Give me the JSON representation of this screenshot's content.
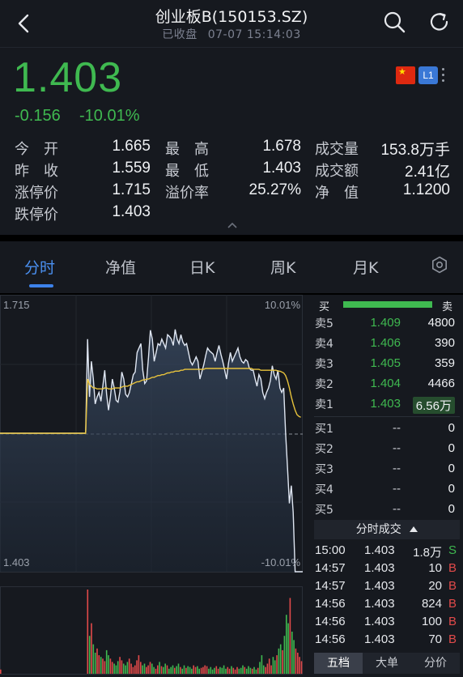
{
  "header": {
    "title": "创业板B(150153.SZ)",
    "status": "已收盘",
    "timestamp": "07-07 15:14:03",
    "icons": [
      "back-icon",
      "search-icon",
      "refresh-icon"
    ]
  },
  "quote": {
    "price": "1.403",
    "change": "-0.156",
    "change_pct": "-10.01%",
    "level_badge": "L1",
    "flag_symbol": "★",
    "up_color": "#e24a4a",
    "down_color": "#3fb950"
  },
  "stats": {
    "open_label": "今　开",
    "open": "1.665",
    "high_label": "最　高",
    "high": "1.678",
    "volume_label": "成交量",
    "volume": "153.8万手",
    "prev_label": "昨　收",
    "prev": "1.559",
    "low_label": "最　低",
    "low": "1.403",
    "amount_label": "成交额",
    "amount": "2.41亿",
    "limit_up_label": "涨停价",
    "limit_up": "1.715",
    "premium_label": "溢价率",
    "premium": "25.27%",
    "nav_label": "净　值",
    "nav": "1.1200",
    "limit_down_label": "跌停价",
    "limit_down": "1.403"
  },
  "tabs": [
    "分时",
    "净值",
    "日K",
    "周K",
    "月K"
  ],
  "chart": {
    "y_max_label": "1.715",
    "y_min_label": "1.403",
    "pct_max_label": "10.01%",
    "pct_min_label": "-10.01%"
  },
  "chart_data": {
    "type": "line",
    "ylim": [
      1.403,
      1.715
    ],
    "prev_close": 1.559,
    "series": [
      {
        "values": [
          1.559,
          1.559,
          1.559,
          1.559,
          1.559,
          1.559,
          1.559,
          1.559,
          1.559,
          1.559,
          1.559,
          1.559,
          1.559,
          1.559,
          1.559,
          1.559,
          1.559,
          1.559,
          1.559,
          1.559,
          1.559,
          1.559,
          1.559,
          1.559,
          1.559,
          1.559,
          1.559,
          1.559,
          1.559,
          1.559,
          1.559,
          1.559,
          1.559,
          1.559,
          1.559,
          1.559,
          1.559,
          1.559,
          1.559,
          1.559,
          1.559,
          1.559,
          1.559,
          1.559,
          1.559,
          1.559,
          1.665,
          1.6,
          1.64,
          1.62,
          1.592,
          1.6,
          1.605,
          1.595,
          1.612,
          1.63,
          1.603,
          1.585,
          1.6,
          1.62,
          1.61,
          1.596,
          1.594,
          1.606,
          1.628,
          1.62,
          1.603,
          1.6,
          1.605,
          1.615,
          1.625,
          1.628,
          1.65,
          1.655,
          1.66,
          1.63,
          1.615,
          1.618,
          1.645,
          1.675,
          1.665,
          1.64,
          1.65,
          1.66,
          1.658,
          1.665,
          1.66,
          1.655,
          1.67,
          1.668,
          1.665,
          1.658,
          1.676,
          1.665,
          1.66,
          1.67,
          1.662,
          1.658,
          1.66,
          1.65,
          1.64,
          1.636,
          1.64,
          1.645,
          1.64,
          1.62,
          1.628,
          1.636,
          1.646,
          1.655,
          1.652,
          1.65,
          1.648,
          1.64,
          1.65,
          1.658,
          1.648,
          1.64,
          1.63,
          1.62,
          1.638,
          1.65,
          1.64,
          1.645,
          1.65,
          1.655,
          1.645,
          1.64,
          1.638,
          1.642,
          1.64,
          1.632,
          1.63,
          1.63,
          1.62,
          1.612,
          1.625,
          1.62,
          1.605,
          1.598,
          1.605,
          1.61,
          1.618,
          1.635,
          1.625,
          1.62,
          1.63,
          1.61,
          1.605,
          1.61,
          1.56,
          1.52,
          1.48,
          1.5,
          1.47,
          1.403,
          1.403,
          1.403,
          1.403,
          1.403
        ]
      },
      {
        "values": [
          1.559,
          1.559,
          1.559,
          1.559,
          1.559,
          1.559,
          1.559,
          1.559,
          1.559,
          1.559,
          1.559,
          1.559,
          1.559,
          1.559,
          1.559,
          1.559,
          1.559,
          1.559,
          1.559,
          1.559,
          1.559,
          1.559,
          1.559,
          1.559,
          1.559,
          1.559,
          1.559,
          1.559,
          1.559,
          1.559,
          1.559,
          1.559,
          1.559,
          1.559,
          1.559,
          1.559,
          1.559,
          1.559,
          1.559,
          1.559,
          1.559,
          1.559,
          1.559,
          1.559,
          1.559,
          1.559,
          1.62,
          1.614,
          1.612,
          1.61,
          1.61,
          1.609,
          1.609,
          1.609,
          1.609,
          1.61,
          1.61,
          1.609,
          1.609,
          1.609,
          1.61,
          1.61,
          1.61,
          1.61,
          1.611,
          1.612,
          1.612,
          1.612,
          1.613,
          1.614,
          1.615,
          1.616,
          1.617,
          1.617,
          1.618,
          1.619,
          1.619,
          1.62,
          1.62,
          1.621,
          1.622,
          1.622,
          1.623,
          1.624,
          1.624,
          1.625,
          1.625,
          1.626,
          1.627,
          1.627,
          1.628,
          1.628,
          1.629,
          1.629,
          1.629,
          1.63,
          1.63,
          1.631,
          1.631,
          1.631,
          1.631,
          1.631,
          1.631,
          1.631,
          1.631,
          1.631,
          1.631,
          1.631,
          1.632,
          1.632,
          1.632,
          1.632,
          1.632,
          1.632,
          1.632,
          1.632,
          1.632,
          1.632,
          1.632,
          1.632,
          1.632,
          1.632,
          1.632,
          1.632,
          1.632,
          1.632,
          1.632,
          1.632,
          1.632,
          1.632,
          1.632,
          1.632,
          1.632,
          1.631,
          1.631,
          1.631,
          1.631,
          1.63,
          1.63,
          1.63,
          1.63,
          1.63,
          1.63,
          1.63,
          1.63,
          1.63,
          1.629,
          1.629,
          1.628,
          1.627,
          1.624,
          1.618,
          1.61,
          1.6,
          1.592,
          1.585,
          1.58,
          1.578,
          1.577
        ]
      }
    ],
    "volume": {
      "values": [
        5,
        0,
        0,
        0,
        0,
        0,
        0,
        0,
        0,
        0,
        0,
        0,
        0,
        0,
        0,
        0,
        0,
        0,
        0,
        0,
        0,
        0,
        0,
        0,
        0,
        0,
        0,
        0,
        0,
        0,
        0,
        0,
        0,
        0,
        0,
        0,
        0,
        0,
        0,
        0,
        0,
        0,
        0,
        0,
        0,
        0,
        100,
        45,
        60,
        35,
        25,
        30,
        22,
        20,
        18,
        15,
        28,
        22,
        18,
        14,
        12,
        10,
        15,
        20,
        16,
        12,
        10,
        14,
        18,
        12,
        8,
        10,
        16,
        22,
        14,
        10,
        12,
        8,
        10,
        14,
        12,
        8,
        6,
        10,
        14,
        9,
        8,
        12,
        10,
        6,
        8,
        10,
        7,
        9,
        12,
        8,
        6,
        10,
        7,
        9,
        8,
        6,
        10,
        8,
        9,
        6,
        7,
        8,
        10,
        9,
        6,
        8,
        5,
        7,
        9,
        6,
        8,
        7,
        10,
        6,
        8,
        6,
        9,
        7,
        5,
        8,
        6,
        7,
        10,
        8,
        6,
        9,
        7,
        6,
        8,
        5,
        7,
        14,
        22,
        10,
        8,
        12,
        18,
        10,
        20,
        16,
        22,
        30,
        35,
        28,
        45,
        70,
        60,
        90,
        50,
        40,
        30,
        25,
        20,
        15
      ],
      "colors": [
        "red",
        "green"
      ]
    }
  },
  "order_book": {
    "header_buy": "买",
    "header_sell": "卖",
    "asks": [
      {
        "label": "卖5",
        "price": "1.409",
        "qty": "4800"
      },
      {
        "label": "卖4",
        "price": "1.406",
        "qty": "390"
      },
      {
        "label": "卖3",
        "price": "1.405",
        "qty": "359"
      },
      {
        "label": "卖2",
        "price": "1.404",
        "qty": "4466"
      },
      {
        "label": "卖1",
        "price": "1.403",
        "qty": "6.56万"
      }
    ],
    "bids": [
      {
        "label": "买1",
        "price": "--",
        "qty": "0"
      },
      {
        "label": "买2",
        "price": "--",
        "qty": "0"
      },
      {
        "label": "买3",
        "price": "--",
        "qty": "0"
      },
      {
        "label": "买4",
        "price": "--",
        "qty": "0"
      },
      {
        "label": "买5",
        "price": "--",
        "qty": "0"
      }
    ]
  },
  "ticks": {
    "title": "分时成交",
    "rows": [
      {
        "time": "15:00",
        "price": "1.403",
        "vol": "1.8万",
        "dir": "S"
      },
      {
        "time": "14:57",
        "price": "1.403",
        "vol": "10",
        "dir": "B"
      },
      {
        "time": "14:57",
        "price": "1.403",
        "vol": "20",
        "dir": "B"
      },
      {
        "time": "14:56",
        "price": "1.403",
        "vol": "824",
        "dir": "B"
      },
      {
        "time": "14:56",
        "price": "1.403",
        "vol": "100",
        "dir": "B"
      },
      {
        "time": "14:56",
        "price": "1.403",
        "vol": "70",
        "dir": "B"
      }
    ]
  },
  "bottom_tabs": [
    "五档",
    "大单",
    "分价"
  ]
}
